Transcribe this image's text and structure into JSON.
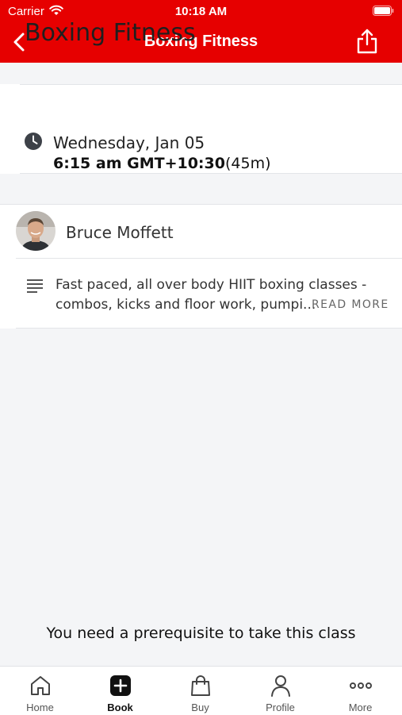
{
  "status_bar": {
    "carrier": "Carrier",
    "time": "10:18 AM"
  },
  "nav": {
    "title": "Boxing Fitness"
  },
  "class_info": {
    "title": "Boxing Fitness",
    "date": "Wednesday, Jan 05",
    "time": "6:15 am GMT+10:30",
    "duration": "(45m)"
  },
  "instructor": {
    "name": "Bruce Moffett"
  },
  "description": {
    "line1": "Fast paced, all over body HIIT boxing classes -",
    "line2": "combos, kicks and floor work, pumpi...",
    "read_more": "READ MORE"
  },
  "prerequisite_message": "You need a prerequisite to take this class",
  "tabs": [
    {
      "label": "Home",
      "icon": "home-icon"
    },
    {
      "label": "Book",
      "icon": "plus-square-icon",
      "active": true
    },
    {
      "label": "Buy",
      "icon": "shopping-bag-icon"
    },
    {
      "label": "Profile",
      "icon": "person-icon"
    },
    {
      "label": "More",
      "icon": "ellipsis-icon"
    }
  ],
  "colors": {
    "brand": "#e60000",
    "background": "#f4f5f7",
    "card": "#ffffff"
  }
}
